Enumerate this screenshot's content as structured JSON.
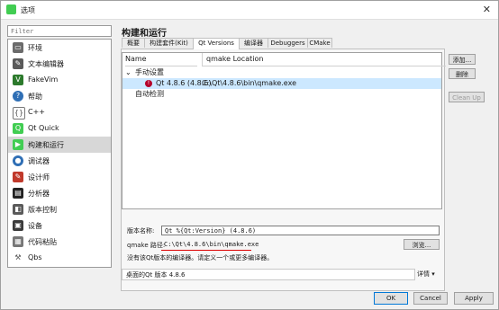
{
  "window": {
    "title": "选项",
    "close_glyph": "✕"
  },
  "filter": {
    "placeholder": "Filter"
  },
  "sidebar": {
    "items": [
      {
        "label": "环境",
        "icon": "environment-icon",
        "color": "#6b6b6b"
      },
      {
        "label": "文本编辑器",
        "icon": "text-editor-icon",
        "color": "#5a5a5a"
      },
      {
        "label": "FakeVim",
        "icon": "fakevim-icon",
        "color": "#2c7a2c"
      },
      {
        "label": "帮助",
        "icon": "help-icon",
        "color": "#2f6fb5"
      },
      {
        "label": "C++",
        "icon": "cpp-icon",
        "color": "#777777"
      },
      {
        "label": "Qt Quick",
        "icon": "qtquick-icon",
        "color": "#41cd52"
      },
      {
        "label": "构建和运行",
        "icon": "build-run-icon",
        "color": "#41cd52"
      },
      {
        "label": "调试器",
        "icon": "debugger-icon",
        "color": "#2f6fb5"
      },
      {
        "label": "设计师",
        "icon": "designer-icon",
        "color": "#c0392b"
      },
      {
        "label": "分析器",
        "icon": "analyzer-icon",
        "color": "#222222"
      },
      {
        "label": "版本控制",
        "icon": "version-control-icon",
        "color": "#5a5a5a"
      },
      {
        "label": "设备",
        "icon": "devices-icon",
        "color": "#3a3a3a"
      },
      {
        "label": "代码粘贴",
        "icon": "code-paste-icon",
        "color": "#777777"
      },
      {
        "label": "Qbs",
        "icon": "qbs-icon",
        "color": "#555555"
      }
    ]
  },
  "main": {
    "header": "构建和运行",
    "tabs": [
      "概要",
      "构建套件(Kit)",
      "Qt Versions",
      "编译器",
      "Debuggers",
      "CMake"
    ],
    "tree": {
      "columns": [
        "Name",
        "qmake Location"
      ],
      "groups": {
        "manual": "手动设置",
        "auto": "自动检测"
      },
      "selected_entry": {
        "name": "Qt 4.8.6 (4.8.6)",
        "location": "C:\\Qt\\4.8.6\\bin\\qmake.exe"
      }
    },
    "side_buttons": {
      "add": "添加...",
      "remove": "删除",
      "cleanup": "Clean Up"
    },
    "detail": {
      "name_label": "版本名称:",
      "name_value": "Qt %{Qt:Version} (4.8.6)",
      "qmake_label": "qmake 路径:",
      "qmake_value": "C:\\Qt\\4.8.6\\bin\\qmake.exe",
      "browse": "浏览...",
      "warning": "没有该Qt版本的编译器。请定义一个或更多编译器。"
    },
    "status": {
      "text": "桌面的Qt 版本 4.8.6",
      "details": "详情 ▾"
    }
  },
  "footer": {
    "ok": "OK",
    "cancel": "Cancel",
    "apply": "Apply"
  }
}
